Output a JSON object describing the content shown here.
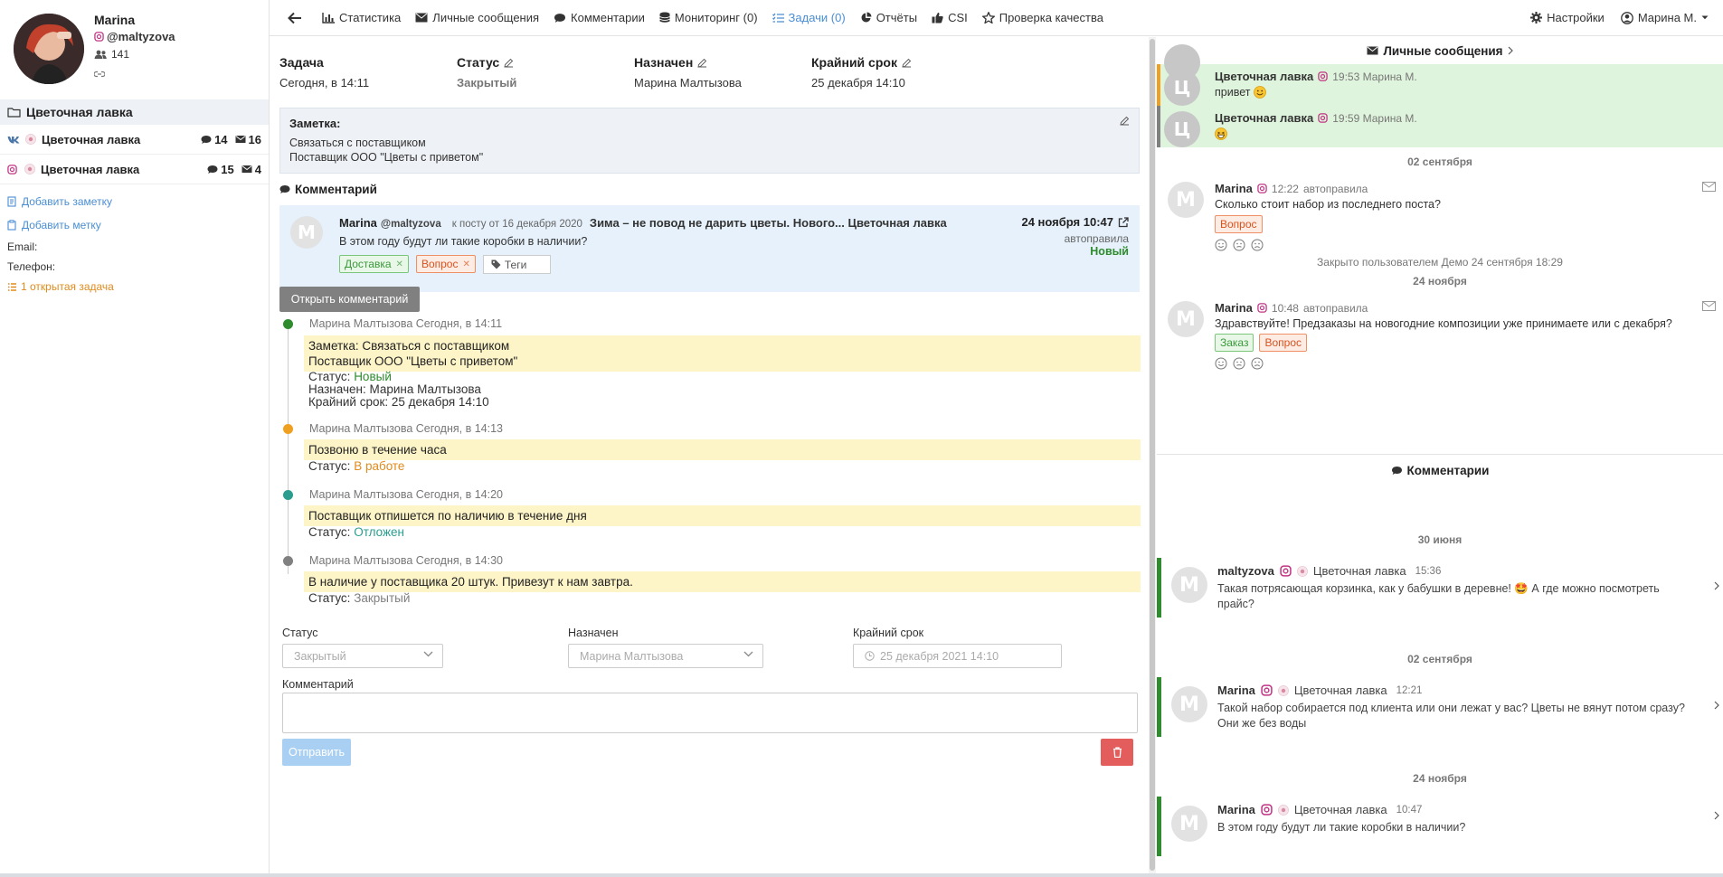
{
  "colors": {
    "accent": "#4a8ed4",
    "green": "#2e8b2e",
    "orange": "#e08b1d",
    "teal": "#2a9d8f",
    "grey": "#808080",
    "highlight": "#fdf4c8",
    "comment_bg": "#e6f1fb",
    "incoming_bg": "#dff4dc"
  },
  "profile": {
    "name": "Marina",
    "login": "@maltyzova",
    "followers": "141"
  },
  "sidebar": {
    "folder": "Цветочная лавка",
    "accounts": [
      {
        "network": "vk",
        "name": "Цветочная лавка",
        "comments": "14",
        "messages": "16"
      },
      {
        "network": "instagram",
        "name": "Цветочная лавка",
        "comments": "15",
        "messages": "4"
      }
    ],
    "add_note": "Добавить заметку",
    "add_tag": "Добавить метку",
    "email_label": "Email:",
    "phone_label": "Телефон:",
    "open_tasks": "1 открытая задача"
  },
  "nav": {
    "items": [
      {
        "icon": "bar-chart-icon",
        "label": "Статистика"
      },
      {
        "icon": "envelope-icon",
        "label": "Личные сообщения"
      },
      {
        "icon": "comment-icon",
        "label": "Комментарии"
      },
      {
        "icon": "database-icon",
        "label": "Мониторинг (0)"
      },
      {
        "icon": "tasks-icon",
        "label": "Задачи (0)"
      },
      {
        "icon": "pie-chart-icon",
        "label": "Отчёты"
      },
      {
        "icon": "thumbs-up-icon",
        "label": "CSI"
      },
      {
        "icon": "star-icon",
        "label": "Проверка качества"
      }
    ],
    "settings": "Настройки",
    "user": "Марина М."
  },
  "task": {
    "task_label": "Задача",
    "task_value": "Сегодня, в 14:11",
    "status_label": "Статус",
    "status_value": "Закрытый",
    "assigned_label": "Назначен",
    "assigned_value": "Марина Малтызова",
    "deadline_label": "Крайний срок",
    "deadline_value": "25 декабря 14:10",
    "note_label": "Заметка:",
    "note_line1": "Связаться с поставщиком",
    "note_line2": "Поставщик ООО \"Цветы с приветом\"",
    "comment_header": "Комментарий"
  },
  "comment_card": {
    "avatar_letter": "M",
    "author": "Marina",
    "login": "@maltyzova",
    "meta": "к посту от 16 декабря 2020",
    "post_title": "Зима – не повод не дарить цветы. Нового... Цветочная лавка",
    "date": "24 ноября 10:47",
    "auto": "автоправила",
    "status": "Новый",
    "text": "В этом году будут ли такие коробки в наличии?",
    "tags": [
      "Доставка",
      "Вопрос"
    ],
    "tags_placeholder": "Теги",
    "open_button": "Открыть комментарий"
  },
  "timeline": [
    {
      "meta": "Марина Малтызова Сегодня, в 14:11",
      "dot": "#2e8b2e",
      "highlight": [
        "Заметка: Связаться с поставщиком",
        "Поставщик ООО \"Цветы с приветом\""
      ],
      "status_prefix": "Статус: ",
      "status": "Новый",
      "status_color": "#2e8b2e",
      "assigned": "Назначен: Марина Малтызова",
      "deadline": "Крайний срок: 25 декабря 14:10"
    },
    {
      "meta": "Марина Малтызова Сегодня, в 14:13",
      "dot": "#f0a020",
      "highlight": [
        "Позвоню в течение часа"
      ],
      "status_prefix": "Статус: ",
      "status": "В работе",
      "status_color": "#e08b1d"
    },
    {
      "meta": "Марина Малтызова Сегодня, в 14:20",
      "dot": "#2a9d8f",
      "highlight": [
        "Поставщик отпишется по наличию в течение дня"
      ],
      "status_prefix": "Статус: ",
      "status": "Отложен",
      "status_color": "#2a9d8f"
    },
    {
      "meta": "Марина Малтызова Сегодня, в 14:30",
      "dot": "#808080",
      "highlight": [
        "В наличие у поставщика 20 штук. Привезут к нам завтра."
      ],
      "status_prefix": "Статус: ",
      "status": "Закрытый",
      "status_color": "#808080"
    }
  ],
  "form": {
    "status_label": "Статус",
    "status_value": "Закрытый",
    "assigned_label": "Назначен",
    "assigned_value": "Марина Малтызова",
    "deadline_label": "Крайний срок",
    "deadline_value": "25 декабря 2021 14:10",
    "comment_label": "Комментарий",
    "send": "Отправить"
  },
  "right": {
    "pm_header": "Личные сообщения",
    "incoming": [
      {
        "avatar": "Ц",
        "name": "Цветочная лавка",
        "time": "19:53 Марина М.",
        "text": "привет",
        "emoji": "smile",
        "bar": "#f0a020"
      },
      {
        "avatar": "Ц",
        "name": "Цветочная лавка",
        "time": "19:59 Марина М.",
        "text": "",
        "emoji": "grin",
        "bar": "#808080"
      }
    ],
    "date1": "02 сентября",
    "msg1": {
      "avatar": "M",
      "name": "Marina",
      "time": "12:22",
      "auto": "автоправила",
      "text": "Сколько стоит набор из последнего поста?",
      "tags": [
        "Вопрос"
      ]
    },
    "closed": "Закрыто пользователем Демо 24 сентября 18:29",
    "date2": "24 ноября",
    "msg2": {
      "avatar": "M",
      "name": "Marina",
      "time": "10:48",
      "auto": "автоправила",
      "text": "Здравствуйте! Предзаказы на новогодние композиции уже принимаете или с декабря?",
      "tags": [
        "Заказ",
        "Вопрос"
      ]
    },
    "comments_header": "Комментарии",
    "comments": [
      {
        "date": "30 июня",
        "avatar": "M",
        "name": "maltyzova",
        "account": "Цветочная лавка",
        "time": "15:36",
        "text1": "Такая потрясающая корзинка, как у бабушки в деревне! 🤩 А где можно посмотреть",
        "text2": "прайс?"
      },
      {
        "date": "02 сентября",
        "avatar": "M",
        "name": "Marina",
        "account": "Цветочная лавка",
        "time": "12:21",
        "text1": "Такой набор собирается под клиента или они лежат у вас? Цветы не вянут потом сразу?",
        "text2": "Они же без воды"
      },
      {
        "date": "24 ноября",
        "avatar": "M",
        "name": "Marina",
        "account": "Цветочная лавка",
        "time": "10:47",
        "text1": "В этом году будут ли такие коробки в наличии?",
        "text2": ""
      }
    ]
  }
}
